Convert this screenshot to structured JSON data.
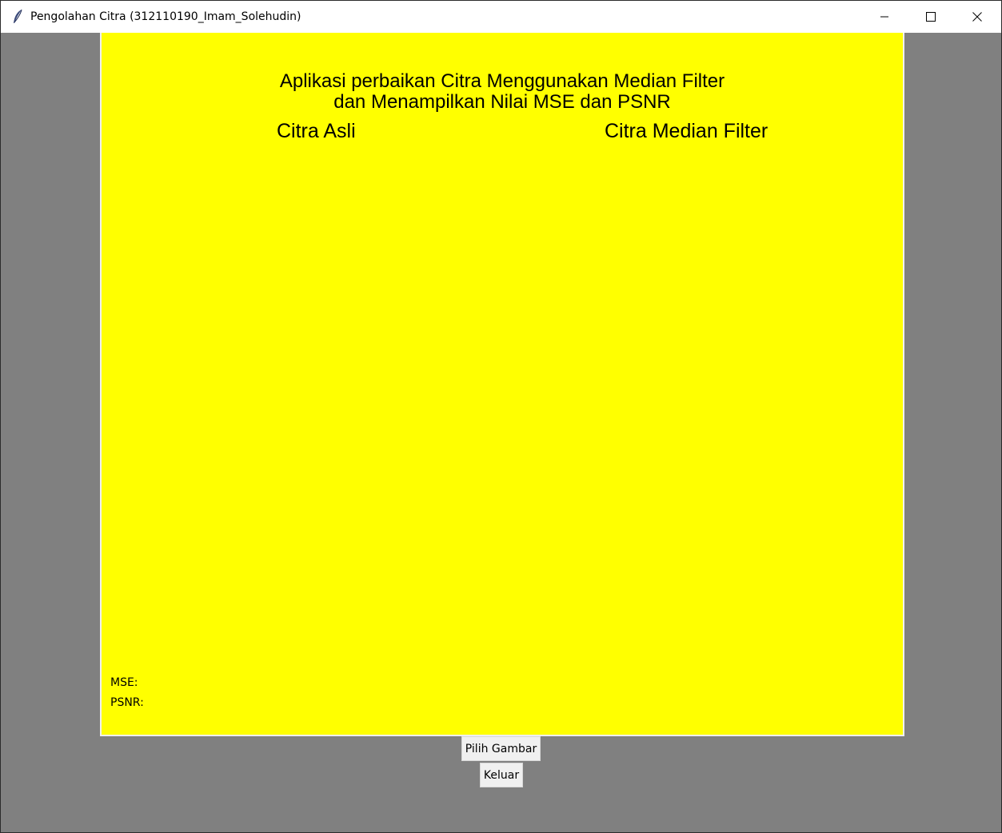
{
  "window": {
    "title": "Pengolahan Citra (312110190_Imam_Solehudin)",
    "controls": {
      "minimize_icon": "minimize-icon",
      "maximize_icon": "maximize-icon",
      "close_icon": "close-icon"
    },
    "app_icon": "feather-icon"
  },
  "canvas": {
    "background": "#ffff00",
    "heading_line1": "Aplikasi perbaikan Citra Menggunakan Median Filter",
    "heading_line2": "dan Menampilkan Nilai MSE dan PSNR",
    "label_original": "Citra Asli",
    "label_filtered": "Citra Median Filter",
    "mse_label": "MSE:",
    "psnr_label": "PSNR:"
  },
  "buttons": {
    "choose_image": "Pilih Gambar",
    "exit": "Keluar"
  },
  "colors": {
    "window_background": "#808080",
    "titlebar": "#ffffff",
    "button_face": "#f0f0f0"
  }
}
